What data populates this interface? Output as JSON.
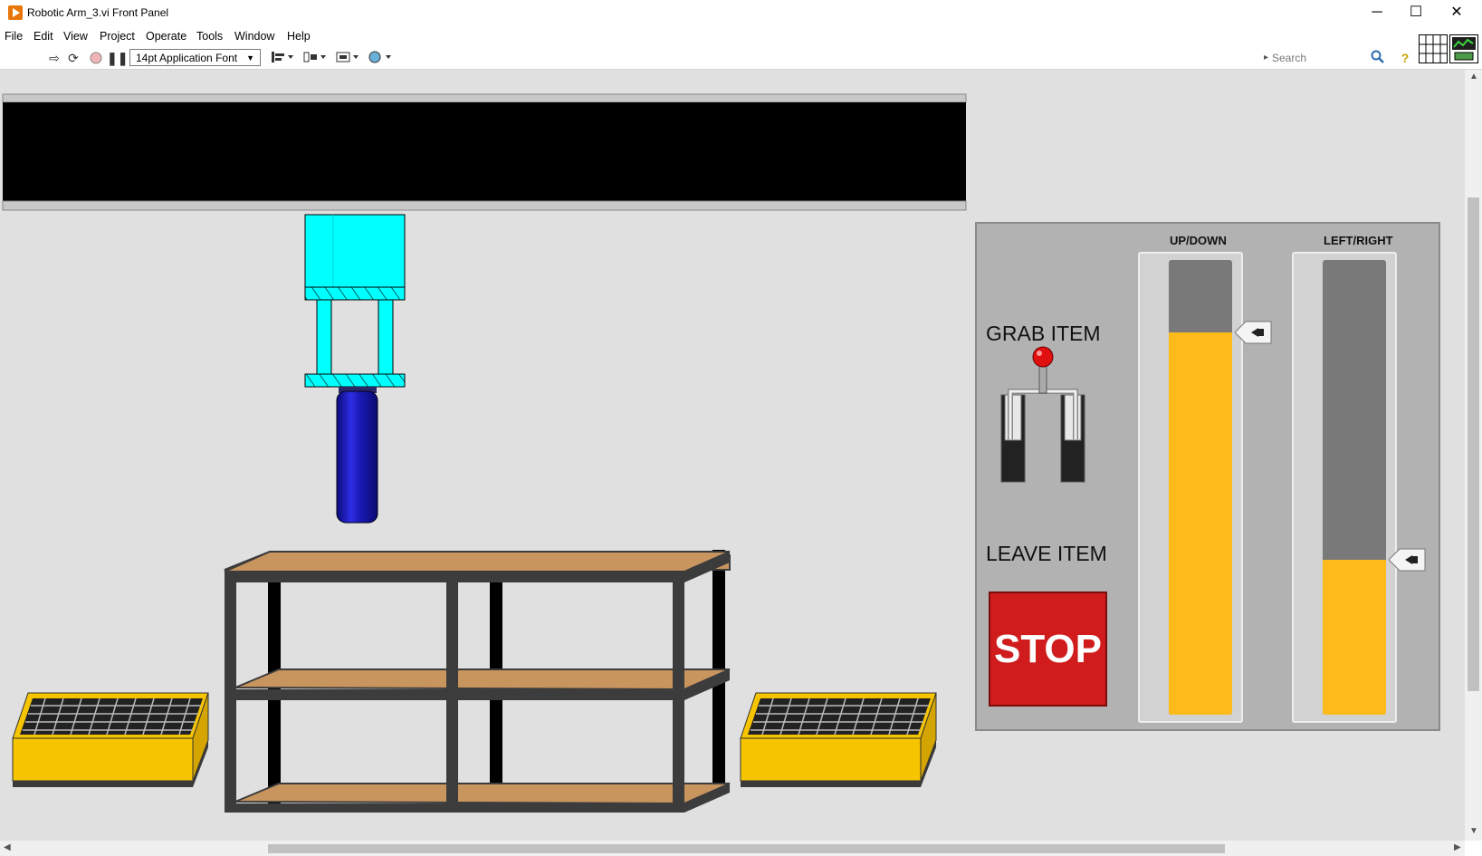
{
  "window": {
    "title": "Robotic Arm_3.vi Front Panel",
    "minimize": "─",
    "maximize": "☐",
    "close": "✕"
  },
  "menu": [
    "File",
    "Edit",
    "View",
    "Project",
    "Operate",
    "Tools",
    "Window",
    "Help"
  ],
  "toolbar": {
    "font_select": "14pt Application Font",
    "search_placeholder": "Search",
    "icons": [
      "run-arrow-icon",
      "run-continuously-icon",
      "abort-icon",
      "pause-icon",
      "align-objects-icon",
      "distribute-objects-icon",
      "resize-objects-icon",
      "reorder-icon",
      "search-icon",
      "help-icon",
      "connector-pane-icon",
      "vi-icon"
    ]
  },
  "controls": {
    "grab_label": "GRAB ITEM",
    "leave_label": "LEAVE ITEM",
    "stop_label": "STOP",
    "updown": {
      "label": "UP/DOWN",
      "fraction": 0.84
    },
    "leftright": {
      "label": "LEFT/RIGHT",
      "fraction": 0.34
    }
  },
  "colors": {
    "arm": "#00ffff",
    "bottle": "#1010b4",
    "rail": "#000000",
    "shelf_wood": "#c9955f",
    "shelf_frame": "#3c3c3c",
    "crate": "#f7c400",
    "slider_fill": "#fdbb1b",
    "stop": "#d01c1c"
  }
}
